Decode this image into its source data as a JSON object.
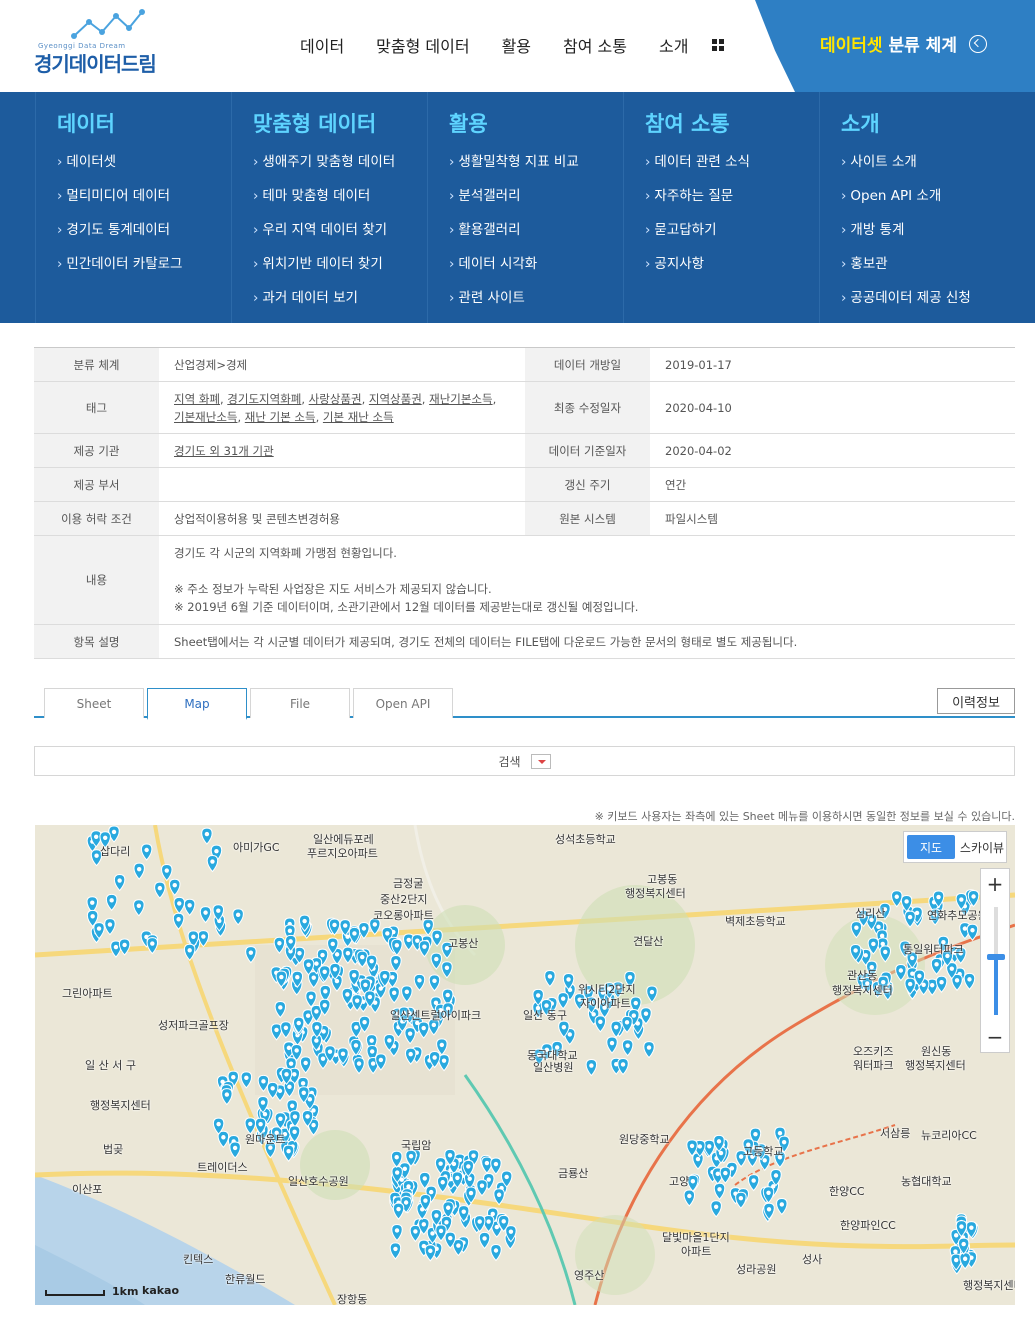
{
  "logo": {
    "sub": "Gyeonggi Data Dream",
    "name": "경기데이터드림"
  },
  "nav": {
    "items": [
      "데이터",
      "맞춤형 데이터",
      "활용",
      "참여 소통",
      "소개"
    ]
  },
  "dataset_panel": {
    "highlight": "데이터셋",
    "rest": "분류 체계"
  },
  "mega_menu": [
    {
      "title": "데이터",
      "items": [
        "데이터셋",
        "멀티미디어 데이터",
        "경기도 통계데이터",
        "민간데이터 카탈로그"
      ]
    },
    {
      "title": "맞춤형 데이터",
      "items": [
        "생애주기 맞춤형 데이터",
        "테마 맞춤형 데이터",
        "우리 지역 데이터 찾기",
        "위치기반 데이터 찾기",
        "과거 데이터 보기"
      ]
    },
    {
      "title": "활용",
      "items": [
        "생활밀착형 지표 비교",
        "분석갤러리",
        "활용갤러리",
        "데이터 시각화",
        "관련 사이트"
      ]
    },
    {
      "title": "참여 소통",
      "items": [
        "데이터 관련 소식",
        "자주하는 질문",
        "묻고답하기",
        "공지사항"
      ]
    },
    {
      "title": "소개",
      "items": [
        "사이트 소개",
        "Open API 소개",
        "개방 통계",
        "홍보관",
        "공공데이터 제공 신청"
      ]
    }
  ],
  "info": {
    "category_label": "분류 체계",
    "category": "산업경제>경제",
    "open_date_label": "데이터 개방일",
    "open_date": "2019-01-17",
    "tag_label": "태그",
    "tags_line1": [
      "지역 화폐",
      "경기도지역화폐",
      "사랑상품권",
      "지역상품권",
      "재난기본소득"
    ],
    "tags_line2": [
      "기본재난소득",
      "재난 기본 소득",
      "기본 재난 소득"
    ],
    "modified_label": "최종 수정일자",
    "modified": "2020-04-10",
    "provider_label": "제공 기관",
    "provider": "경기도 외 31개 기관",
    "base_date_label": "데이터 기준일자",
    "base_date": "2020-04-02",
    "dept_label": "제공 부서",
    "dept": "",
    "cycle_label": "갱신 주기",
    "cycle": "연간",
    "license_label": "이용 허락 조건",
    "license": "상업적이용허용 및 콘텐츠변경허용",
    "system_label": "원본 시스템",
    "system": "파일시스템",
    "content_label": "내용",
    "content_1": "경기도 각 시군의 지역화폐 가맹점 현황입니다.",
    "content_2": "※ 주소 정보가 누락된 사업장은 지도 서비스가 제공되지 않습니다.",
    "content_3": "※ 2019년 6월 기준 데이터이며, 소관기관에서 12월 데이터를 제공받는대로 갱신될 예정입니다.",
    "item_label": "항목 설명",
    "item_desc": "Sheet탭에서는 각 시군별 데이터가 제공되며, 경기도 전체의 데이터는 FILE탭에 다운로드 가능한 문서의 형태로 별도 제공됩니다."
  },
  "tabs": [
    "Sheet",
    "Map",
    "File",
    "Open API"
  ],
  "history_button": "이력정보",
  "search_label": "검색",
  "keyboard_note": "※ 키보드 사용자는 좌측에 있는 Sheet 메뉴를 이용하시면 동일한 정보를 보실 수 있습니다.",
  "map": {
    "type_map": "지도",
    "type_sky": "스카이뷰",
    "scale_label": "1km",
    "provider": "kakao",
    "labels": [
      "삽다리",
      "아미가GC",
      "일산에듀포레",
      "푸르지오아파트",
      "성석초등학교",
      "금정굴",
      "중산2단지",
      "코오롱아파트",
      "고봉동",
      "행정복지센터",
      "벽제초등학교",
      "심리산",
      "연화추모공원",
      "고봉산",
      "견달산",
      "통일워터파크",
      "관산동",
      "행정복지센터",
      "그린아파트",
      "성저파크골프장",
      "위시티2단지",
      "자이아파트",
      "일산센트럴아이파크",
      "일산 동구",
      "동국대학교",
      "일산병원",
      "오즈키즈",
      "워터파크",
      "원신동",
      "행정복지센터",
      "일 산 서 구",
      "행정복지센터",
      "원마운트",
      "트레이더스",
      "국립암",
      "원당중학교",
      "고등학교",
      "서삼릉",
      "뉴코리아CC",
      "일산호수공원",
      "금룡산",
      "고양",
      "한양CC",
      "농협대학교",
      "이산포",
      "킨텍스",
      "한류월드",
      "영주산",
      "달빛마을1단지",
      "아파트",
      "성라공원",
      "한양파인CC",
      "성사",
      "장항동",
      "행정복지센터",
      "법곶"
    ]
  }
}
